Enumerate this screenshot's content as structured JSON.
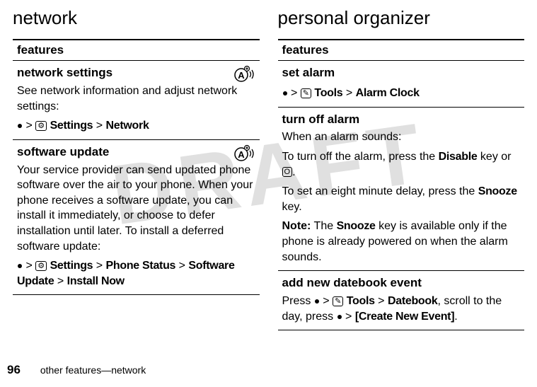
{
  "watermark": "DRAFT",
  "left": {
    "heading": "network",
    "table_header": "features",
    "rows": [
      {
        "title": "network settings",
        "body": "See network information and adjust network settings:",
        "path_parts": [
          "Settings",
          "Network"
        ],
        "has_icon": true
      },
      {
        "title": "software update",
        "body": "Your service provider can send updated phone software over the air to your phone. When your phone receives a software update, you can install it immediately, or choose to defer installation until later. To install a deferred software update:",
        "path_parts": [
          "Settings",
          "Phone Status",
          "Software Update",
          "Install Now"
        ],
        "has_icon": true
      }
    ]
  },
  "right": {
    "heading": "personal organizer",
    "table_header": "features",
    "rows": [
      {
        "title": "set alarm",
        "body": "",
        "path_parts": [
          "Tools",
          "Alarm Clock"
        ],
        "has_icon": false
      },
      {
        "title": "turn off alarm",
        "body1": "When an alarm sounds:",
        "body2_pre": "To turn off the alarm, press the ",
        "body2_bold": "Disable",
        "body2_post": " key or ",
        "body2_badge": "O",
        "body2_end": ".",
        "body3_pre": "To set an eight minute delay, press the ",
        "body3_bold": "Snooze",
        "body3_post": " key.",
        "note_label": "Note:",
        "note_pre": " The ",
        "note_bold": "Snooze",
        "note_post": " key is available only if the phone is already powered on when the alarm sounds."
      },
      {
        "title": "add new datebook event",
        "body_pre": "Press ",
        "path_parts": [
          "Tools",
          "Datebook"
        ],
        "body_mid": ", scroll to the day, press ",
        "path2_parts": [
          "[Create New Event]"
        ],
        "body_end": "."
      }
    ]
  },
  "footer": {
    "page_number": "96",
    "text": "other features—network"
  }
}
